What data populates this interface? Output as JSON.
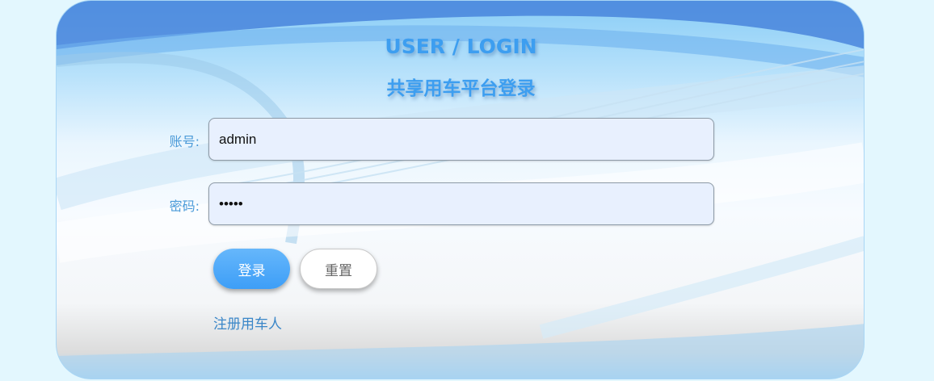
{
  "header": {
    "title_en": "USER / LOGIN",
    "title_cn": "共享用车平台登录"
  },
  "form": {
    "account_label": "账号:",
    "account_value": "admin",
    "password_label": "密码:",
    "password_value": "admin"
  },
  "buttons": {
    "login_label": "登录",
    "reset_label": "重置"
  },
  "links": {
    "register_label": "注册用车人"
  },
  "colors": {
    "page_background": "#e3f7fe",
    "accent": "#3d9ef0",
    "link": "#3a86c8"
  }
}
